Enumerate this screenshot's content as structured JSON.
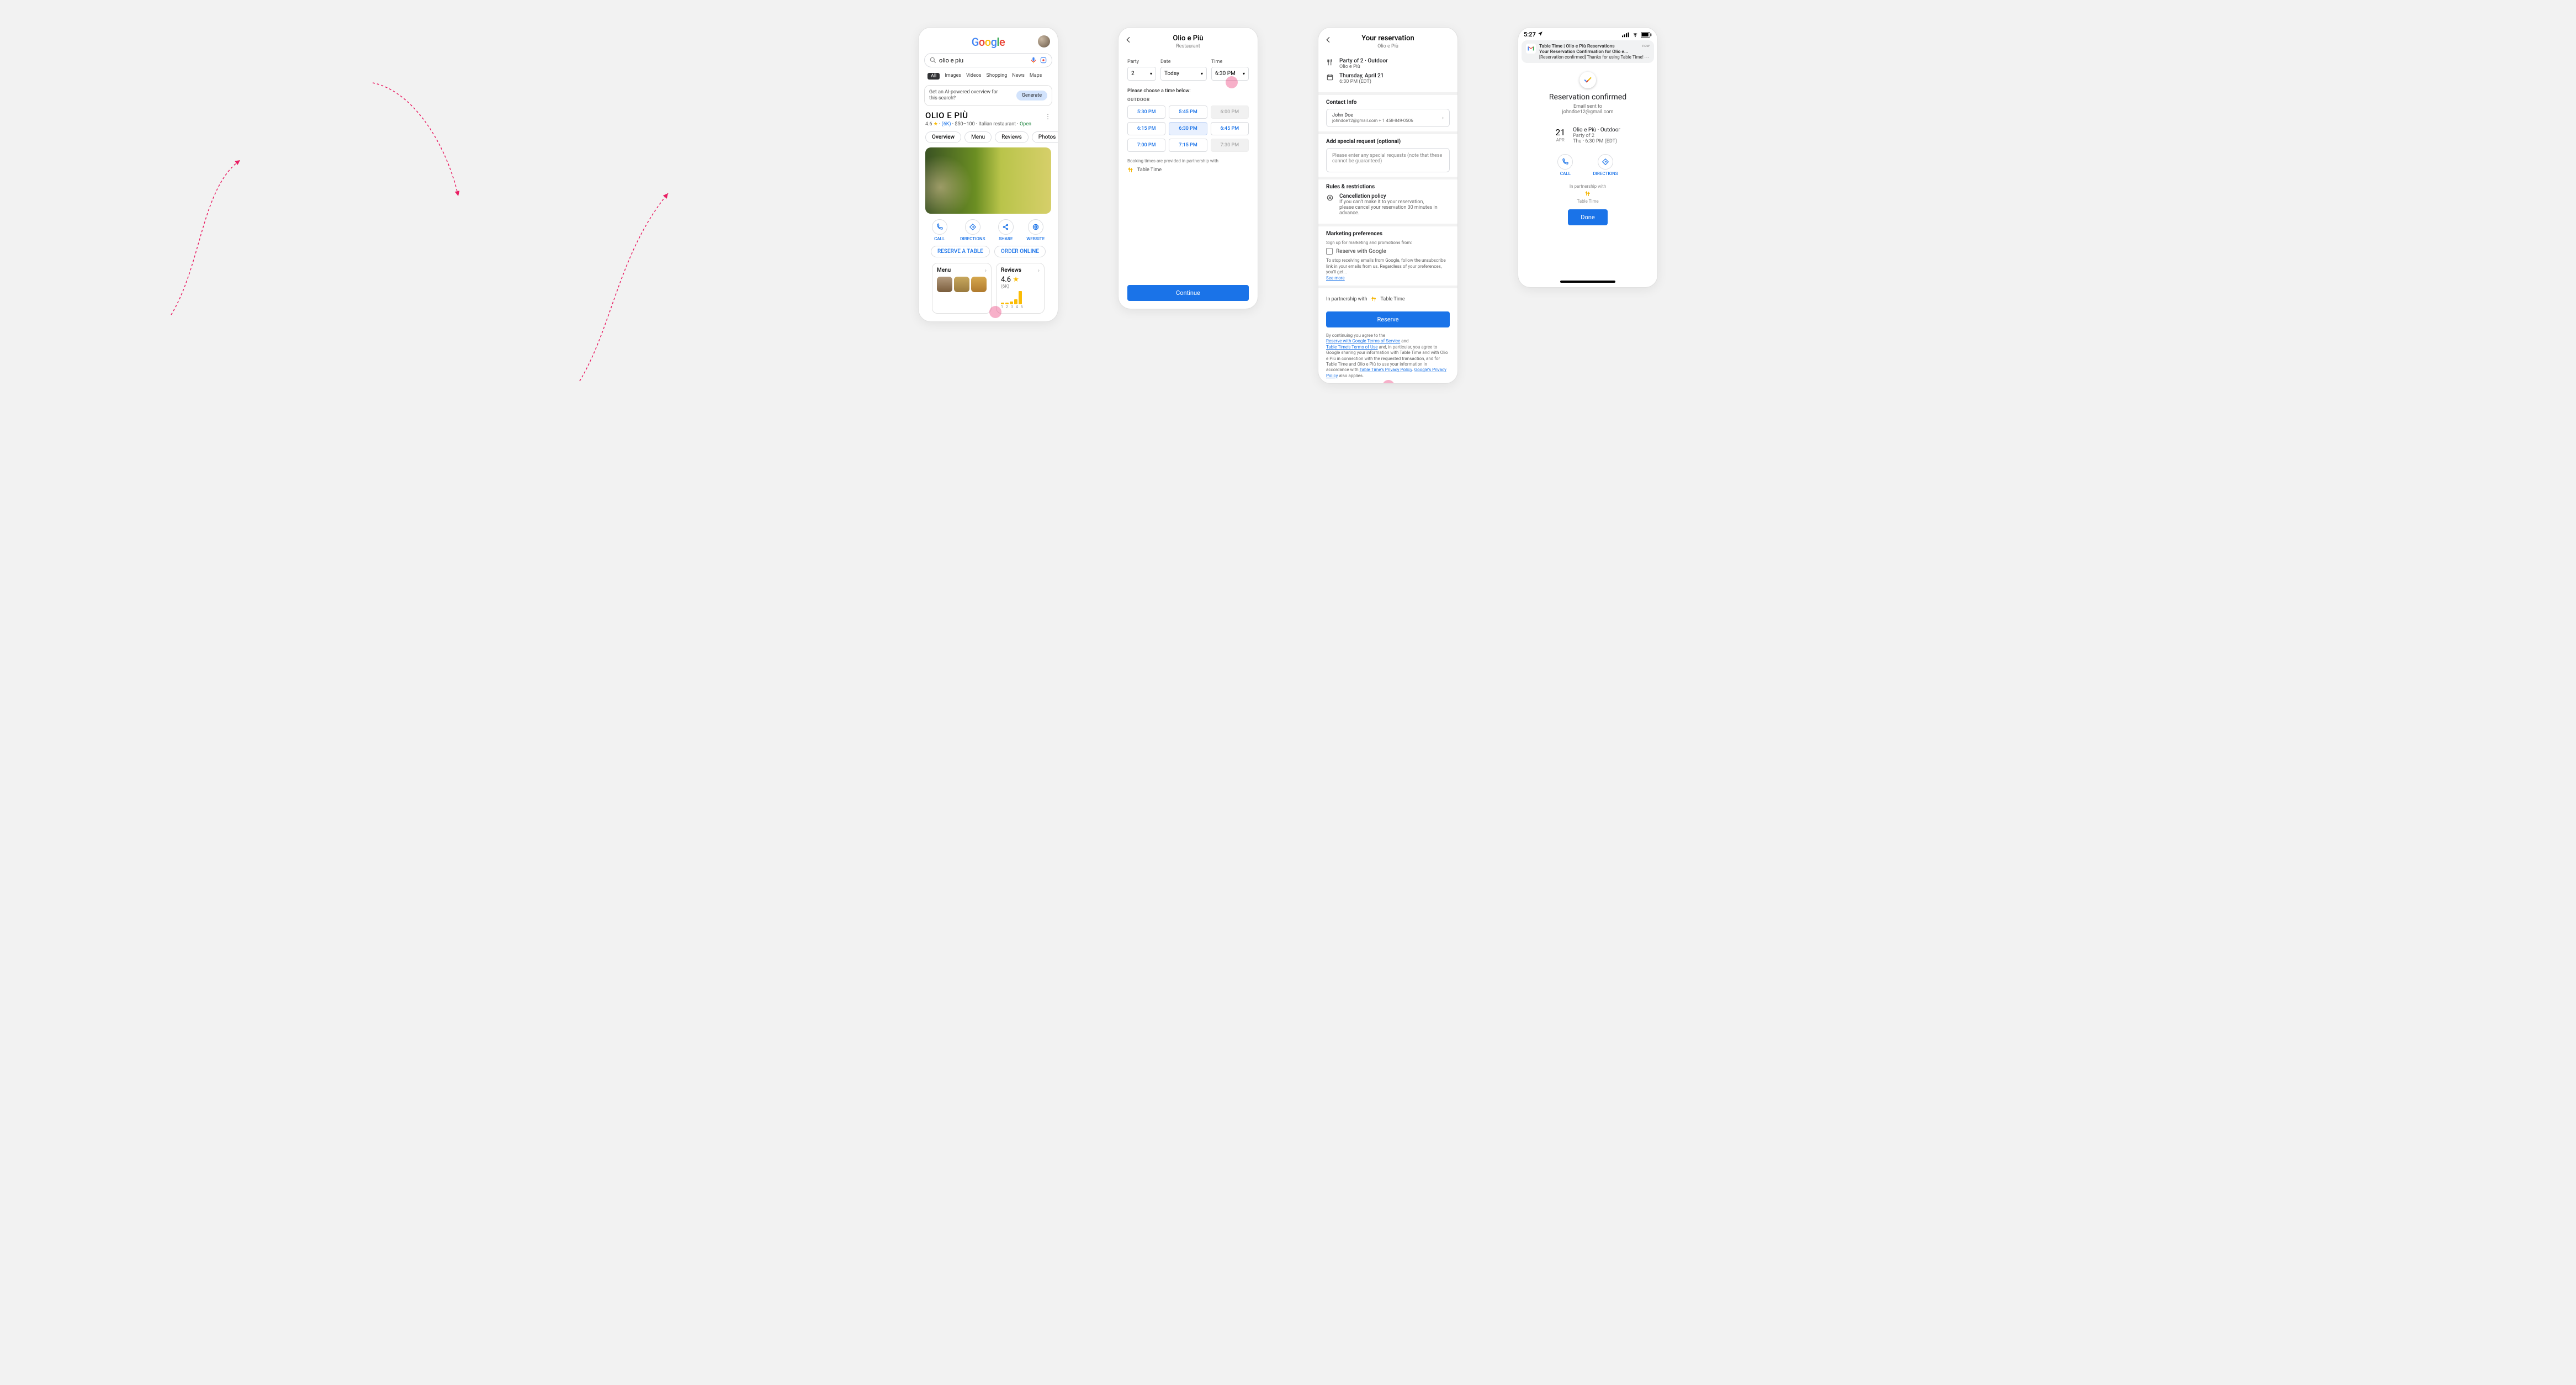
{
  "colors": {
    "primary": "#1a73e8",
    "pink": "#e91e63"
  },
  "s1": {
    "search_query": "olio e piu",
    "tabs": [
      "All",
      "Images",
      "Videos",
      "Shopping",
      "News",
      "Maps"
    ],
    "ai_prompt": "Get an AI-powered overview for this search?",
    "ai_button": "Generate",
    "biz_name": "OLIO E PIÙ",
    "rating": "4.6",
    "star": "★",
    "reviews_link": "(6K)",
    "price": "$50–100",
    "cuisine": "Italian restaurant",
    "status": "Open",
    "biz_tabs": [
      "Overview",
      "Menu",
      "Reviews",
      "Photos"
    ],
    "actions": [
      {
        "icon": "phone",
        "label": "CALL"
      },
      {
        "icon": "diamond",
        "label": "DIRECTIONS"
      },
      {
        "icon": "share",
        "label": "SHARE"
      },
      {
        "icon": "globe",
        "label": "WEBSITE"
      }
    ],
    "buttons": {
      "reserve": "RESERVE A TABLE",
      "order": "ORDER ONLINE"
    },
    "menu_card": "Menu",
    "reviews_card": "Reviews",
    "reviews_rating": "4.6",
    "reviews_count": "(6K)",
    "spark_labels": [
      "1",
      "2",
      "3",
      "4",
      "5"
    ]
  },
  "s2": {
    "title": "Olio e Più",
    "subtitle": "Restaurant",
    "party_label": "Party",
    "date_label": "Date",
    "time_label": "Time",
    "party_value": "2",
    "date_value": "Today",
    "time_value": "6:30 PM",
    "choose": "Please choose a time below:",
    "category": "OUTDOOR",
    "slots": [
      {
        "t": "5:30 PM",
        "s": "ok"
      },
      {
        "t": "5:45 PM",
        "s": "ok"
      },
      {
        "t": "6:00 PM",
        "s": "dis"
      },
      {
        "t": "6:15 PM",
        "s": "ok"
      },
      {
        "t": "6:30 PM",
        "s": "sel"
      },
      {
        "t": "6:45 PM",
        "s": "ok"
      },
      {
        "t": "7:00 PM",
        "s": "ok"
      },
      {
        "t": "7:15 PM",
        "s": "ok"
      },
      {
        "t": "7:30 PM",
        "s": "dis"
      }
    ],
    "foot": "Booking times are provided in partnership with",
    "partner": "Table Time",
    "continue": "Continue"
  },
  "s3": {
    "title": "Your reservation",
    "subtitle": "Olio e Più",
    "summary_party": "Party of 2 · Outdoor",
    "summary_rest": "Olio e Più",
    "summary_day": "Thursday, April 21",
    "summary_time": "6:30 PM (EDT)",
    "contact_title": "Contact Info",
    "contact_name": "John Doe",
    "contact_details": "johndoe12@gmail.com   + 1 458-849-0506",
    "request_title": "Add special request (optional)",
    "request_placeholder": "Please enter any special requests (note that these cannot be guaranteed)",
    "rules_title": "Rules & restrictions",
    "rules_sub": "Cancellation policy",
    "rules_body": "If you can't make it to your reservation, please cancel your reservation 30 minutes in advance.",
    "mkt_title": "Marketing preferences",
    "mkt_line": "Sign up for marketing and promotions from:",
    "mkt_check": "Reserve with Google",
    "mkt_stop": "To stop receiving emails from Google, follow the unsubscribe link in your emails from us. Regardless of your preferences, you'll get...",
    "see_more": "See more",
    "in_partner": "In partnership with",
    "partner": "Table Time",
    "reserve": "Reserve",
    "legal_1": "By continuing you agree to the",
    "legal_2": "Reserve with Google Terms of Service",
    "legal_and": " and",
    "legal_3": "Table Time's Terms of Use",
    "legal_4": " and, in particular, you agree to Google sharing your information with  Table Time  and with Olio e Più  in connection with the requested transaction, and for Table Time  and Olio e Più  to use your information in accordance with",
    "legal_5": "Table Time's Privacy Policy",
    "legal_6": "Google's Privacy Policy",
    "legal_7": " also applies."
  },
  "s4": {
    "status_time": "5:27",
    "notif_app": "Table Time | Olio e Più Reservations",
    "notif_now": "now",
    "notif_subj": "Your Reservation Confirmation for Olio e...",
    "notif_body": "[Reservation confirmed] Thanks for using Table Time!",
    "conf_title": "Reservation confirmed",
    "conf_sub1": "Email sent to",
    "conf_sub2": "johndoe12@gmail.com",
    "date_num": "21",
    "date_mon": "APR",
    "conf_line1": "Olio e Più · Outdoor",
    "conf_line2": "Party of 2",
    "conf_line3": "Thu · 6:30 PM (EDT)",
    "act_call": "CALL",
    "act_dir": "DIRECTIONS",
    "part": "In partnership with",
    "partner": "Table Time",
    "done": "Done"
  }
}
